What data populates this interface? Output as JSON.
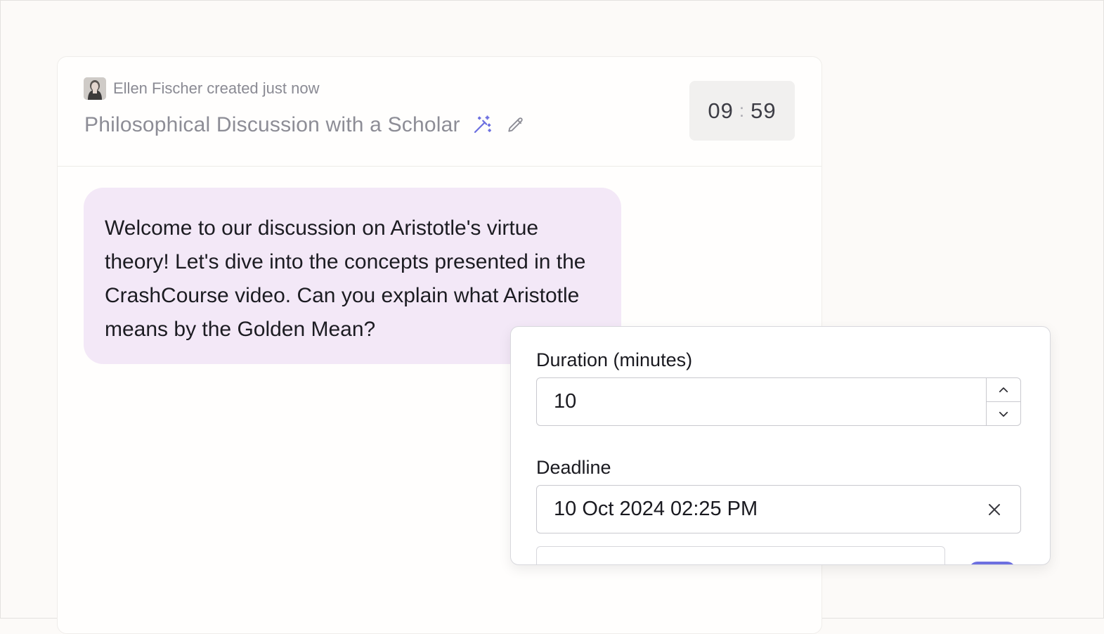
{
  "header": {
    "creator_name": "Ellen Fischer",
    "creator_action": "created just now",
    "title": "Philosophical Discussion with a Scholar",
    "timer": {
      "minutes": "09",
      "separator": ":",
      "seconds": "59"
    }
  },
  "icons": {
    "avatar": "avatar",
    "magic": "magic-wand-icon",
    "edit": "pencil-icon",
    "increment": "chevron-up-icon",
    "decrement": "chevron-down-icon",
    "clear": "close-icon"
  },
  "message": {
    "text": "Welcome to our discussion on Aristotle's virtue theory! Let's dive into the concepts presented in the CrashCourse video. Can you explain what Aristotle means by the Golden Mean?"
  },
  "settings": {
    "duration_label": "Duration (minutes)",
    "duration_value": "10",
    "deadline_label": "Deadline",
    "deadline_value": "10 Oct 2024 02:25 PM"
  },
  "colors": {
    "accent": "#6c6fe0",
    "bubble": "#f3e8f7",
    "background": "#fcfaf8"
  }
}
